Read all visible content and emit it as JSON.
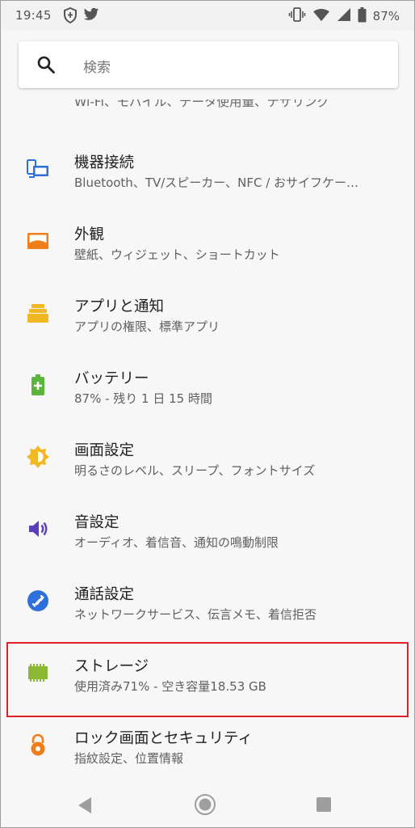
{
  "status_bar": {
    "time": "19:45",
    "left_icons": [
      "shield-icon",
      "twitter-bird-icon"
    ],
    "right_icons": [
      "vibrate-icon",
      "wifi-icon",
      "signal-icon",
      "battery-icon"
    ],
    "battery_text": "87%"
  },
  "search": {
    "placeholder": "検索"
  },
  "partial_row": {
    "subtitle": "Wi-Fi、モバイル、データ使用量、テザリング"
  },
  "settings": {
    "items": [
      {
        "title": "機器接続",
        "subtitle": "Bluetooth、TV/スピーカー、NFC / おサイフケー…",
        "icon": "devices-icon",
        "color": "#2f6fd8"
      },
      {
        "title": "外観",
        "subtitle": "壁紙、ウィジェット、ショートカット",
        "icon": "appearance-icon",
        "color": "#ef7d1a"
      },
      {
        "title": "アプリと通知",
        "subtitle": "アプリの権限、標準アプリ",
        "icon": "apps-icon",
        "color": "#f2b824"
      },
      {
        "title": "バッテリー",
        "subtitle": "87% - 残り 1 日 15 時間",
        "icon": "battery-plus-icon",
        "color": "#5cb53b"
      },
      {
        "title": "画面設定",
        "subtitle": "明るさのレベル、スリープ、フォントサイズ",
        "icon": "brightness-icon",
        "color": "#f2b824"
      },
      {
        "title": "音設定",
        "subtitle": "オーディオ、着信音、通知の鳴動制限",
        "icon": "volume-icon",
        "color": "#5b3fb8"
      },
      {
        "title": "通話設定",
        "subtitle": "ネットワークサービス、伝言メモ、着信拒否",
        "icon": "phone-icon",
        "color": "#2f6fd8"
      },
      {
        "title": "ストレージ",
        "subtitle": "使用済み71% - 空き容量18.53 GB",
        "icon": "storage-chip-icon",
        "color": "#8ab833"
      },
      {
        "title": "ロック画面とセキュリティ",
        "subtitle": "指紋設定、位置情報",
        "icon": "lock-icon",
        "color": "#ef7d1a"
      }
    ],
    "highlighted_color": "#e0202a"
  }
}
